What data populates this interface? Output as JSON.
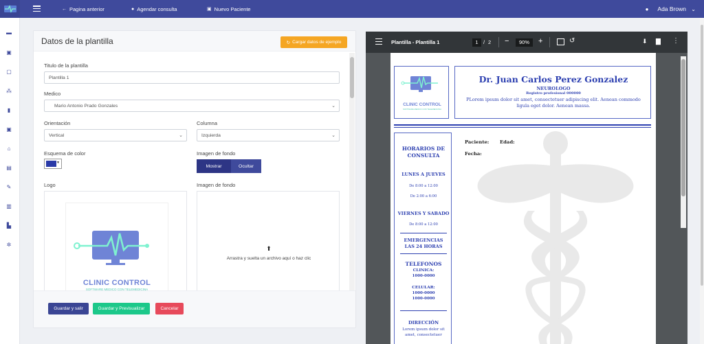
{
  "topbar": {
    "nav": [
      {
        "icon": "arrow-left-icon",
        "glyph": "←",
        "label": "Pagina anterior"
      },
      {
        "icon": "clock-icon",
        "glyph": "●",
        "label": "Agendar consulta"
      },
      {
        "icon": "id-card-icon",
        "glyph": "▣",
        "label": "Nuevo Paciente"
      }
    ],
    "user_name": "Ada Brown"
  },
  "sidebar": {
    "icons": [
      "home-icon",
      "calendar-icon",
      "clipboard-icon",
      "users-icon",
      "trash-icon",
      "user-icon",
      "hospital-icon",
      "file-icon",
      "pen-icon",
      "document-icon",
      "chart-icon",
      "gear-icon"
    ]
  },
  "form": {
    "title": "Datos de la plantilla",
    "sample_button": "Cargar datos de ejemplo",
    "template_title_label": "Titulo de la plantilla",
    "template_title_value": "Plantilla 1",
    "doctor_label": "Medico",
    "doctor_value": "Mario Antonio Prado Gonzales",
    "orientation_label": "Orientación",
    "orientation_value": "Vertical",
    "column_label": "Columna",
    "column_value": "Izquierda",
    "color_scheme_label": "Esquema de color",
    "color_scheme_value": "#2a3aa8",
    "bg_image_label": "Imagen de fondo",
    "show_label": "Mostrar",
    "hide_label": "Ocultar",
    "logo_label": "Logo",
    "bg_image_label_2": "Imagen de fondo",
    "upload_hint": "Arrastra y suelta un archivo aquí o haz clic",
    "save_exit": "Guardar y salir",
    "save_preview": "Guardar y Previsualizar",
    "cancel": "Cancelar"
  },
  "logo": {
    "name": "CLINIC CONTROL",
    "tagline": "SOFTWARE MEDICO CON TELEMEDICINA"
  },
  "pdf": {
    "title": "Plantilla - Plantilla 1",
    "page_current": "1",
    "page_total": "2",
    "zoom": "90%",
    "doctor_name": "Dr. Juan Carlos Perez Gonzalez",
    "specialty": "NEUROLOGO",
    "registry": "Registro profesional 000000",
    "description": "PLorem ipsum dolor sit amet, consectetuer adipiscing elit. Aenean commodo ligula eget dolor. Aenean massa.",
    "hours_title": "HORARIOS DE CONSULTA",
    "weekdays": "LUNES A JUEVES",
    "weekdays_h1": "De 8:00 a 12:00",
    "weekdays_h2": "De 2:00 a 6:00",
    "weekend": "VIERNES Y SABADO",
    "weekend_h1": "De 8:00 a 12:00",
    "emergency": "EMERGENCIAS LAS 24 HORAS",
    "phones": "TELEFONOS",
    "clinic_label": "CLINICA:",
    "clinic_phone": "1000-0000",
    "cell_label": "CELULAR:",
    "cell_phone_1": "1000-0000",
    "cell_phone_2": "1000-0000",
    "address_title": "DIRECCIÓN",
    "address_text": "Lorem ipsum dolor sit amet, consectetuer",
    "patient_label": "Paciente:",
    "age_label": "Edad:",
    "date_label": "Fecha:"
  },
  "colors": {
    "topbar": "#3f4a9c",
    "accent": "#f5a623",
    "primary_btn": "#3a4594",
    "success": "#1cc88a",
    "danger": "#e74a5b"
  }
}
